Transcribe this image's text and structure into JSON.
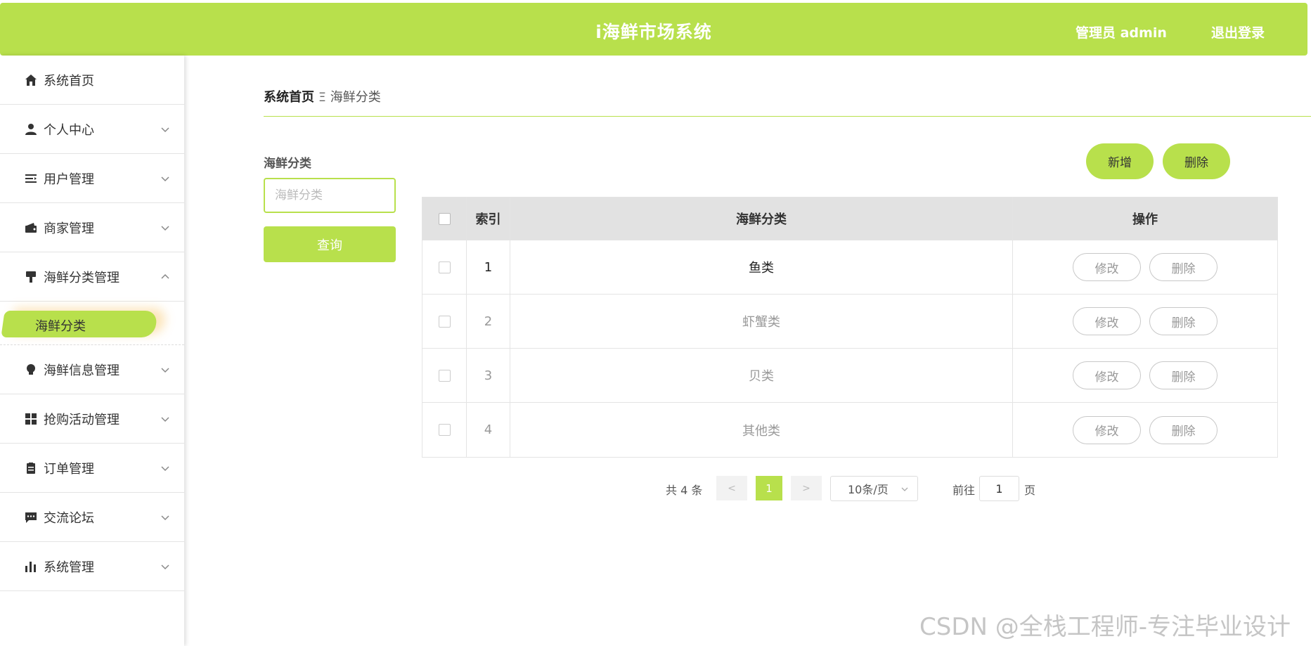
{
  "header": {
    "title": "i海鲜市场系统",
    "user_label": "管理员 admin",
    "logout_label": "退出登录",
    "accent_color": "#b8e04c"
  },
  "sidebar": {
    "items": [
      {
        "label": "系统首页",
        "icon": "home-icon"
      },
      {
        "label": "个人中心",
        "icon": "user-icon"
      },
      {
        "label": "用户管理",
        "icon": "list-icon"
      },
      {
        "label": "商家管理",
        "icon": "wallet-icon"
      },
      {
        "label": "海鲜分类管理",
        "icon": "brush-icon",
        "expanded": true
      },
      {
        "label": "海鲜信息管理",
        "icon": "bulb-icon"
      },
      {
        "label": "抢购活动管理",
        "icon": "grid-icon"
      },
      {
        "label": "订单管理",
        "icon": "clipboard-icon"
      },
      {
        "label": "交流论坛",
        "icon": "chat-icon"
      },
      {
        "label": "系统管理",
        "icon": "bar-chart-icon"
      }
    ],
    "active_sub": "海鲜分类"
  },
  "breadcrumb": {
    "home": "系统首页",
    "separator": "Ξ",
    "current": "海鲜分类"
  },
  "filter": {
    "label": "海鲜分类",
    "placeholder": "海鲜分类",
    "query_button": "查询"
  },
  "actions": {
    "add": "新增",
    "delete": "删除"
  },
  "table": {
    "columns": [
      "索引",
      "海鲜分类",
      "操作"
    ],
    "rows": [
      {
        "index": "1",
        "name": "鱼类"
      },
      {
        "index": "2",
        "name": "虾蟹类"
      },
      {
        "index": "3",
        "name": "贝类"
      },
      {
        "index": "4",
        "name": "其他类"
      }
    ],
    "edit_label": "修改",
    "delete_label": "删除"
  },
  "pagination": {
    "total": "共 4 条",
    "prev": "<",
    "current": "1",
    "next": ">",
    "page_size": "10条/页",
    "goto_label": "前往",
    "goto_value": "1",
    "goto_unit": "页"
  },
  "watermark": "CSDN @全栈工程师-专注毕业设计"
}
